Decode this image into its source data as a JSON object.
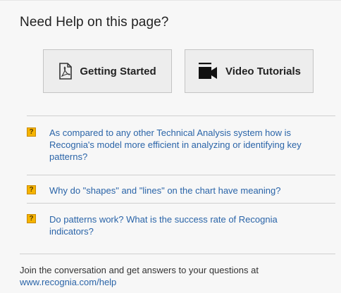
{
  "help": {
    "title": "Need Help on this page?",
    "buttons": {
      "getting_started": "Getting Started",
      "video_tutorials": "Video Tutorials"
    },
    "faq": [
      {
        "icon": "question-badge-icon",
        "text": "As compared to any other Technical Analysis system how is Recognia's model more efficient in analyzing or identifying key patterns?"
      },
      {
        "icon": "question-badge-icon",
        "text": "Why do \"shapes\" and \"lines\" on the chart have meaning?"
      },
      {
        "icon": "question-badge-icon",
        "text": "Do patterns work? What is the success rate of Recognia indicators?"
      }
    ],
    "badge_glyph": "?",
    "footer": {
      "text": "Join the conversation and get answers to your questions at",
      "link": "www.recognia.com/help"
    }
  },
  "colors": {
    "link": "#2a64a8",
    "badge": "#f5b400",
    "button_bg": "#ededed"
  }
}
